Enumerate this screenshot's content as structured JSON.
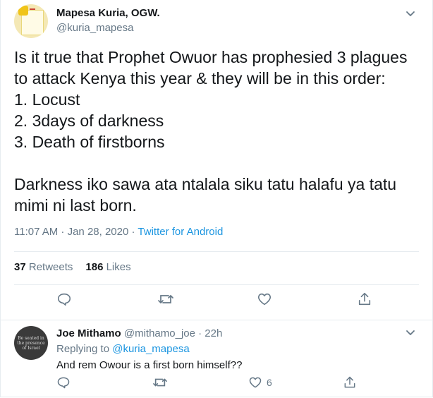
{
  "tweet": {
    "author_name": "Mapesa Kuria, OGW.",
    "author_handle": "@kuria_mapesa",
    "text": "Is it true that Prophet Owuor has prophesied 3 plagues\nto attack Kenya this year & they will be in this order:\n1. Locust\n2. 3days of darkness\n3. Death of firstborns\n\nDarkness iko sawa ata ntalala siku tatu halafu ya tatu\nmimi ni last born.",
    "time": "11:07 AM · Jan 28, 2020 · ",
    "source": "Twitter for Android",
    "retweets_count": "37",
    "retweets_label": "Retweets",
    "likes_count": "186",
    "likes_label": "Likes"
  },
  "reply": {
    "author_name": "Joe Mithamo",
    "author_handle_time": "@mithamo_joe · 22h",
    "replying_prefix": "Replying to ",
    "replying_to": "@kuria_mapesa",
    "text": "And rem Owour is a first born himself??",
    "like_count": "6",
    "avatar_text": "Be seated in the presence of Israel"
  },
  "icons": {
    "reply": "reply-icon",
    "retweet": "retweet-icon",
    "like": "heart-icon",
    "share": "share-icon",
    "more": "chevron-down-icon"
  },
  "colors": {
    "link": "#1b95e0",
    "muted": "#657786",
    "text": "#14171a",
    "divider": "#e6ecf0"
  }
}
